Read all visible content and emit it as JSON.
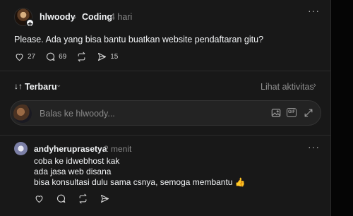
{
  "post": {
    "username": "hlwoody",
    "separator": "›",
    "community": "Coding",
    "time": "4 hari",
    "text": "Please. Ada yang bisa bantu buatkan website pendaftaran gitu?",
    "more": "···",
    "likes": "27",
    "comments": "69",
    "reposts": "",
    "shares": "15"
  },
  "sort": {
    "icon": "↓↑",
    "label": "Terbaru",
    "chevron": "⌄",
    "activity_label": "Lihat aktivitas",
    "activity_chevron": "›"
  },
  "reply": {
    "placeholder": "Balas ke hlwoody...",
    "gif_label": "GIF",
    "plus": "+"
  },
  "comment": {
    "username": "andyheruprasetya",
    "time": "2 menit",
    "more": "···",
    "lines": [
      "coba ke idwebhost kak",
      "ada jasa web disana",
      "bisa konsultasi dulu sama csnya, semoga membantu 👍"
    ]
  },
  "icons": [
    "heart-icon",
    "comment-icon",
    "repost-icon",
    "share-icon",
    "image-icon",
    "gif-icon",
    "expand-icon",
    "plus-icon"
  ],
  "colors": {
    "background": "#181818",
    "text": "#f3f5f7",
    "muted": "#8a8a8a"
  }
}
